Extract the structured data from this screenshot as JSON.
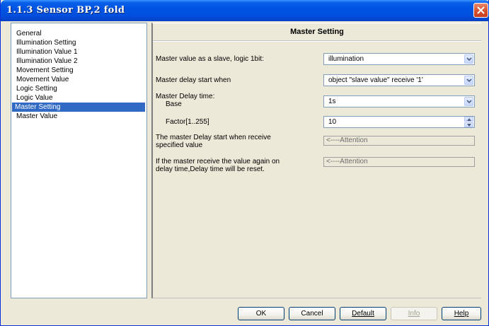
{
  "window": {
    "title": "1.1.3 Sensor BP,2 fold"
  },
  "sidebar": {
    "items": [
      {
        "label": "General"
      },
      {
        "label": "Illumination Setting"
      },
      {
        "label": "Illumination Value 1"
      },
      {
        "label": "Illumination Value 2"
      },
      {
        "label": "Movement Setting"
      },
      {
        "label": "Movement Value"
      },
      {
        "label": "Logic Setting"
      },
      {
        "label": "Logic Value"
      },
      {
        "label": "Master Setting",
        "selected": true
      },
      {
        "label": "Master Value"
      }
    ]
  },
  "main": {
    "title": "Master Setting",
    "fields": {
      "master_value": {
        "label": "Master value as a slave, logic 1bit:",
        "value": "illumination"
      },
      "delay_start": {
        "label": "Master delay start when",
        "value": "object \"slave value\" receive '1'"
      },
      "delay_time": {
        "label": "Master Delay time:"
      },
      "base": {
        "label": "Base",
        "value": "1s"
      },
      "factor": {
        "label": "Factor[1..255]",
        "value": "10"
      },
      "attention1": {
        "label_line1": "The master Delay start when receive",
        "label_line2": "specified value",
        "value": "<----Attention"
      },
      "attention2": {
        "label_line1": "If the master receive the value again on",
        "label_line2": "delay time,Delay time will be reset.",
        "value": "<----Attention"
      }
    }
  },
  "buttons": {
    "ok": "OK",
    "cancel": "Cancel",
    "default": "Default",
    "info": "Info",
    "help": "Help"
  },
  "colors": {
    "title_bar": "#0054e3",
    "selection": "#316ac5",
    "dialog_bg": "#ece9d8",
    "close_button": "#d9532f"
  },
  "icons": [
    "close-icon",
    "chevron-down-icon",
    "spin-up-icon",
    "spin-down-icon"
  ]
}
